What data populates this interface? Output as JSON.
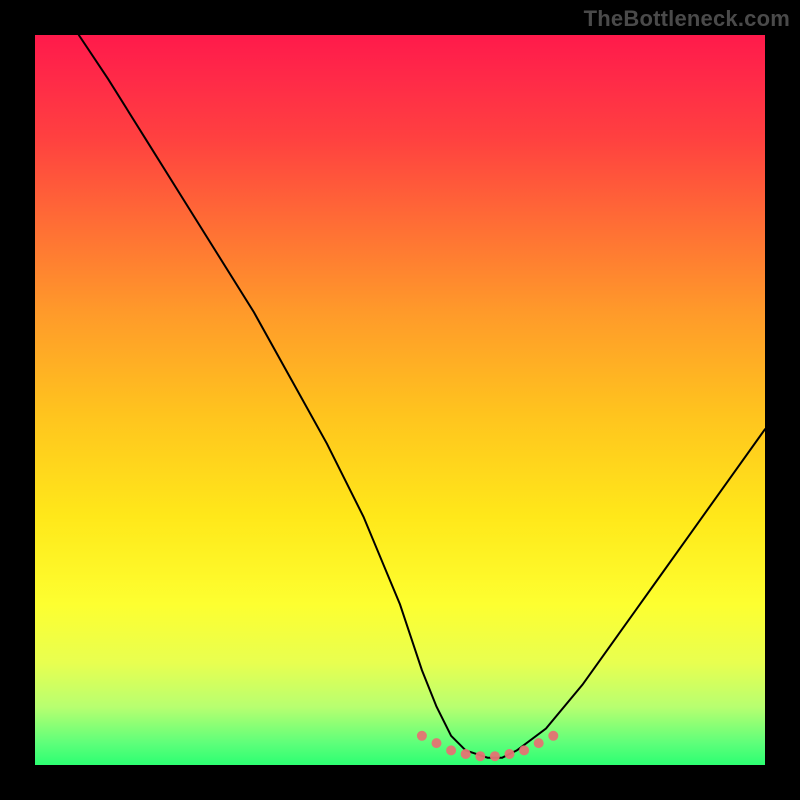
{
  "watermark": "TheBottleneck.com",
  "chart_data": {
    "type": "line",
    "title": "",
    "xlabel": "",
    "ylabel": "",
    "xlim": [
      0,
      100
    ],
    "ylim": [
      0,
      100
    ],
    "grid": false,
    "legend": false,
    "series": [
      {
        "name": "bottleneck-curve",
        "x": [
          6,
          10,
          15,
          20,
          25,
          30,
          35,
          40,
          45,
          50,
          53,
          55,
          57,
          59,
          62,
          64,
          66,
          70,
          75,
          80,
          85,
          90,
          95,
          100
        ],
        "y": [
          100,
          94,
          86,
          78,
          70,
          62,
          53,
          44,
          34,
          22,
          13,
          8,
          4,
          2,
          1,
          1,
          2,
          5,
          11,
          18,
          25,
          32,
          39,
          46
        ]
      }
    ],
    "annotations": [
      {
        "name": "optimal-zone",
        "style": "pink-dots",
        "x": [
          53,
          55,
          57,
          59,
          61,
          63,
          65,
          67,
          69,
          71
        ],
        "y": [
          4,
          3,
          2,
          1.5,
          1.2,
          1.2,
          1.5,
          2,
          3,
          4
        ]
      }
    ],
    "background_gradient": {
      "top": "#ff1a4b",
      "mid": "#ffe81a",
      "bottom": "#2cff72"
    }
  }
}
